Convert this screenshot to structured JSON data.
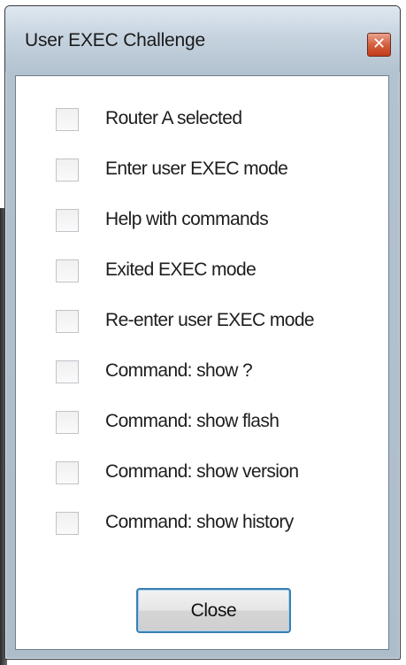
{
  "window": {
    "title": "User EXEC Challenge",
    "close_glyph": "✕"
  },
  "checklist": [
    {
      "label": "Router A selected",
      "checked": false
    },
    {
      "label": "Enter user EXEC mode",
      "checked": false
    },
    {
      "label": "Help with commands",
      "checked": false
    },
    {
      "label": "Exited EXEC mode",
      "checked": false
    },
    {
      "label": "Re-enter user EXEC mode",
      "checked": false
    },
    {
      "label": "Command: show ?",
      "checked": false
    },
    {
      "label": "Command: show flash",
      "checked": false
    },
    {
      "label": "Command: show version",
      "checked": false
    },
    {
      "label": "Command: show history",
      "checked": false
    }
  ],
  "footer": {
    "close_label": "Close"
  },
  "colors": {
    "titlebar": "#c7d4e0",
    "close_x": "#c23c1a",
    "button_border": "#3c7fb1"
  }
}
